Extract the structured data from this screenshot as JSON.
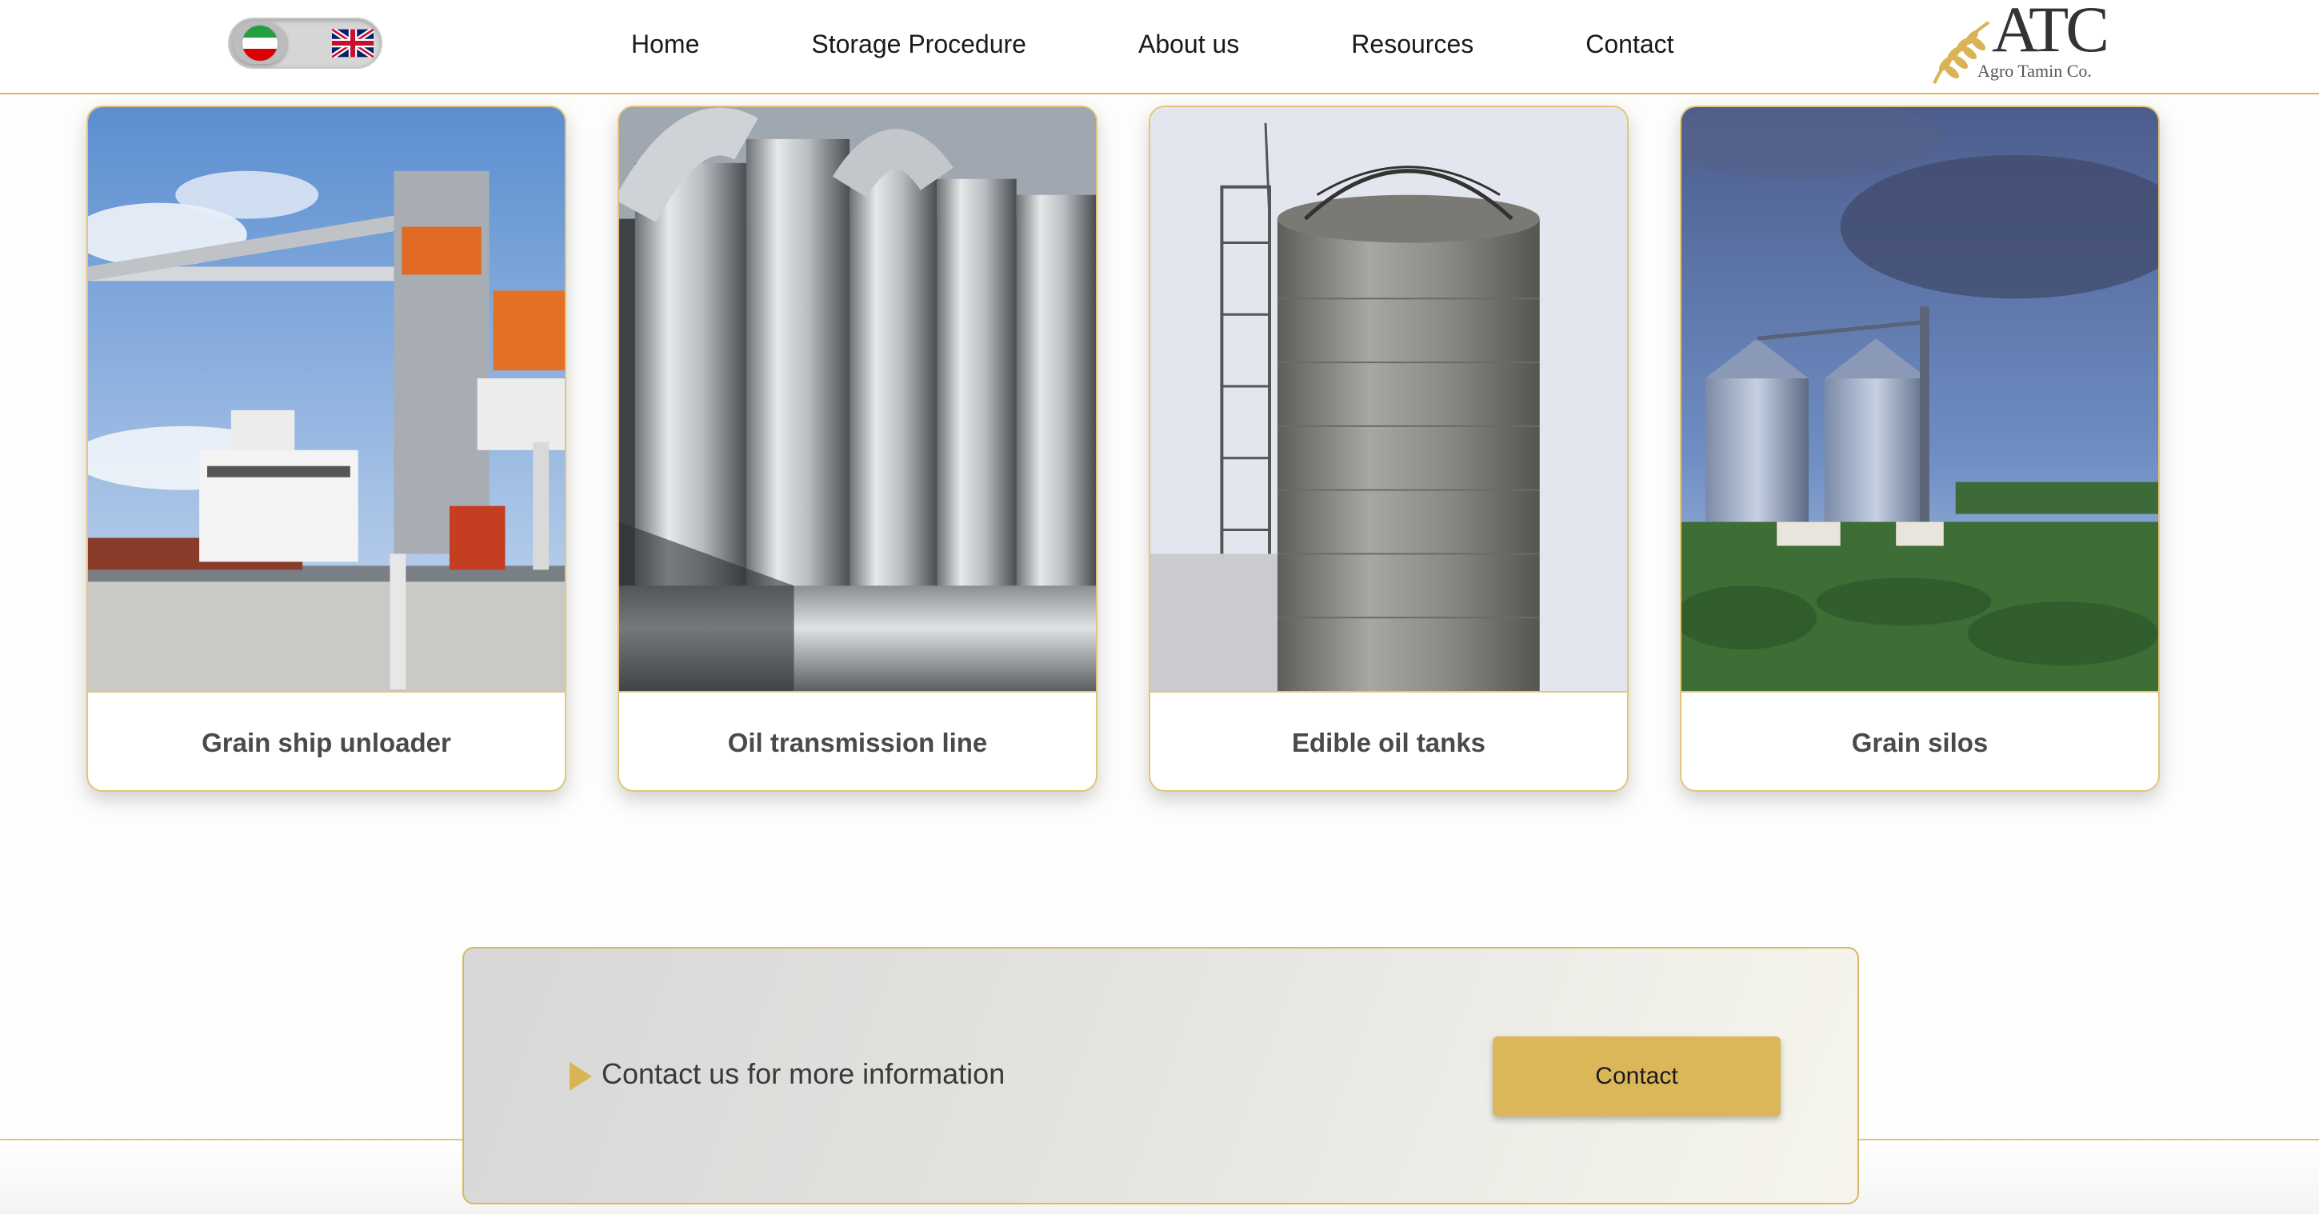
{
  "header": {
    "nav": [
      {
        "label": "Home"
      },
      {
        "label": "Storage Procedure"
      },
      {
        "label": "About us"
      },
      {
        "label": "Resources"
      },
      {
        "label": "Contact"
      }
    ],
    "logo": {
      "mark": "ATC",
      "subtitle": "Agro Tamin Co."
    },
    "language_toggle": {
      "icons": [
        "iran-flag-icon",
        "uk-flag-icon"
      ]
    }
  },
  "cards": [
    {
      "label": "Grain ship unloader"
    },
    {
      "label": "Oil transmission line"
    },
    {
      "label": "Edible oil tanks"
    },
    {
      "label": "Grain silos"
    }
  ],
  "cta": {
    "text": "Contact us for more information",
    "button_label": "Contact"
  },
  "colors": {
    "accent_gold": "#dbb75a",
    "border_gold": "#d9b862",
    "label_gray": "#4a4a4a"
  }
}
